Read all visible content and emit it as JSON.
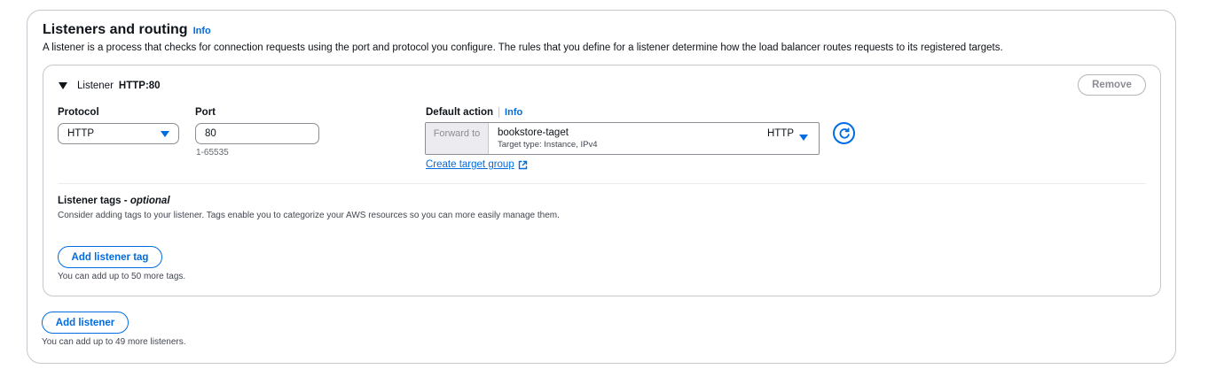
{
  "section": {
    "title": "Listeners and routing",
    "info": "Info",
    "description": "A listener is a process that checks for connection requests using the port and protocol you configure. The rules that you define for a listener determine how the load balancer routes requests to its registered targets."
  },
  "listener": {
    "label": "Listener",
    "value": "HTTP:80",
    "remove_label": "Remove",
    "protocol": {
      "label": "Protocol",
      "value": "HTTP"
    },
    "port": {
      "label": "Port",
      "value": "80",
      "hint": "1-65535"
    },
    "default_action": {
      "label": "Default action",
      "info": "Info",
      "forward_to": "Forward to",
      "target_group": "bookstore-taget",
      "target_type": "Target type: Instance, IPv4",
      "target_protocol": "HTTP",
      "create_link": "Create target group"
    },
    "tags": {
      "title_main": "Listener tags",
      "title_optional": "optional",
      "description": "Consider adding tags to your listener. Tags enable you to categorize your AWS resources so you can more easily manage them.",
      "add_label": "Add listener tag",
      "hint": "You can add up to 50 more tags."
    }
  },
  "add_listener": {
    "label": "Add listener",
    "hint": "You can add up to 49 more listeners."
  },
  "icons": {
    "collapse": "caret-down-icon",
    "dropdown": "triangle-down-icon",
    "refresh": "refresh-icon",
    "external": "external-link-icon"
  },
  "colors": {
    "accent": "#006ce0",
    "border": "#c6c6cd",
    "text": "#0f141a",
    "muted": "#656871"
  }
}
